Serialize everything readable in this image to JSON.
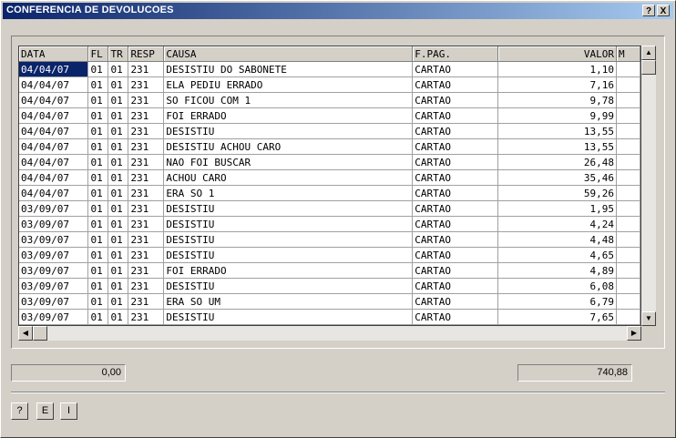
{
  "window": {
    "title": "CONFERENCIA DE DEVOLUCOES",
    "help_label": "?",
    "close_label": "X"
  },
  "grid": {
    "columns": [
      "DATA",
      "FL",
      "TR",
      "RESP",
      "CAUSA",
      "F.PAG.",
      "VALOR",
      "M"
    ],
    "selected_row": 0,
    "rows": [
      [
        "04/04/07",
        "01",
        "01",
        "231",
        "DESISTIU DO SABONETE",
        "CARTAO",
        "1,10"
      ],
      [
        "04/04/07",
        "01",
        "01",
        "231",
        "ELA PEDIU ERRADO",
        "CARTAO",
        "7,16"
      ],
      [
        "04/04/07",
        "01",
        "01",
        "231",
        "SO FICOU COM 1",
        "CARTAO",
        "9,78"
      ],
      [
        "04/04/07",
        "01",
        "01",
        "231",
        "FOI ERRADO",
        "CARTAO",
        "9,99"
      ],
      [
        "04/04/07",
        "01",
        "01",
        "231",
        "DESISTIU",
        "CARTAO",
        "13,55"
      ],
      [
        "04/04/07",
        "01",
        "01",
        "231",
        "DESISTIU ACHOU CARO",
        "CARTAO",
        "13,55"
      ],
      [
        "04/04/07",
        "01",
        "01",
        "231",
        "NAO FOI BUSCAR",
        "CARTAO",
        "26,48"
      ],
      [
        "04/04/07",
        "01",
        "01",
        "231",
        "ACHOU CARO",
        "CARTAO",
        "35,46"
      ],
      [
        "04/04/07",
        "01",
        "01",
        "231",
        "ERA SO 1",
        "CARTAO",
        "59,26"
      ],
      [
        "03/09/07",
        "01",
        "01",
        "231",
        "DESISTIU",
        "CARTAO",
        "1,95"
      ],
      [
        "03/09/07",
        "01",
        "01",
        "231",
        "DESISTIU",
        "CARTAO",
        "4,24"
      ],
      [
        "03/09/07",
        "01",
        "01",
        "231",
        "DESISTIU",
        "CARTAO",
        "4,48"
      ],
      [
        "03/09/07",
        "01",
        "01",
        "231",
        "DESISTIU",
        "CARTAO",
        "4,65"
      ],
      [
        "03/09/07",
        "01",
        "01",
        "231",
        "FOI ERRADO",
        "CARTAO",
        "4,89"
      ],
      [
        "03/09/07",
        "01",
        "01",
        "231",
        "DESISTIU",
        "CARTAO",
        "6,08"
      ],
      [
        "03/09/07",
        "01",
        "01",
        "231",
        "ERA SO UM",
        "CARTAO",
        "6,79"
      ],
      [
        "03/09/07",
        "01",
        "01",
        "231",
        "DESISTIU",
        "CARTAO",
        "7,65"
      ]
    ]
  },
  "totals": {
    "left_value": "0,00",
    "right_value": "740,88"
  },
  "footer": {
    "help_label": "?",
    "e_label": "E",
    "i_label": "I"
  },
  "colors": {
    "titlebar_start": "#0a246a",
    "titlebar_end": "#a6caf0",
    "selection": "#0a246a",
    "face": "#d4d0c8"
  }
}
